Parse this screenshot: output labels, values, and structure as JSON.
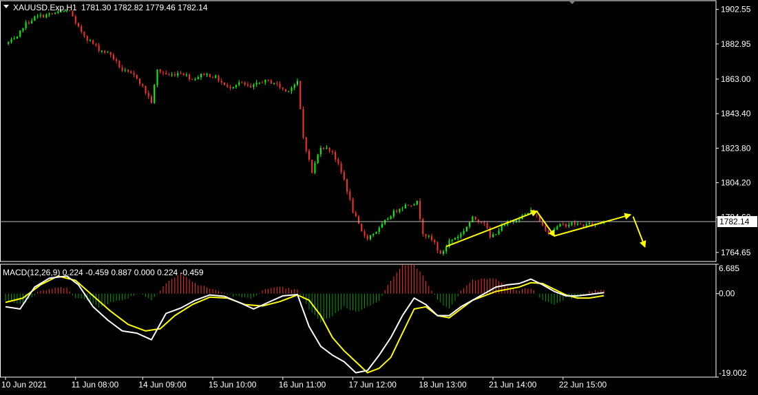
{
  "colors": {
    "background": "#000000",
    "frame": "#ffffff",
    "bull_candle": "#00ff00",
    "bear_candle": "#ff3030",
    "price_line": "#c0c0c0",
    "macd_main": "#ffffff",
    "macd_signal": "#ffff00",
    "hist_pos": "#ff3030",
    "hist_neg": "#00a000",
    "arrow": "#ffff00",
    "label_text": "#ffffff",
    "current_price_bg": "#ffffff",
    "current_price_text": "#000000"
  },
  "header": {
    "symbol_timeframe": "XAUUSD.Exp,H1",
    "ohlc": "1781.30 1782.82 1779.46 1782.14",
    "menu_icon": "triangle-down-icon"
  },
  "chart_data": [
    {
      "type": "candlestick",
      "y_ticks": [
        "1902.55",
        "1882.95",
        "1863.00",
        "1843.40",
        "1823.80",
        "1804.20",
        "1784.60",
        "1764.65"
      ],
      "ylim": [
        1759.5,
        1907.5
      ],
      "current_price": 1782.14,
      "current_price_label": "1782.14",
      "x_tick_labels": [
        "10 Jun 2021",
        "11 Jun 08:00",
        "14 Jun 09:00",
        "15 Jun 10:00",
        "16 Jun 11:00",
        "17 Jun 12:00",
        "18 Jun 13:00",
        "21 Jun 14:00",
        "22 Jun 15:00"
      ],
      "x_tick_bar_index": [
        0,
        24,
        47,
        71,
        95,
        119,
        143,
        167,
        191
      ],
      "grid": false,
      "anchors": [
        [
          0,
          1883
        ],
        [
          4,
          1886
        ],
        [
          6,
          1893
        ],
        [
          10,
          1898
        ],
        [
          16,
          1900
        ],
        [
          22,
          1902
        ],
        [
          24,
          1894
        ],
        [
          28,
          1886
        ],
        [
          32,
          1880
        ],
        [
          36,
          1877
        ],
        [
          40,
          1868
        ],
        [
          45,
          1864
        ],
        [
          50,
          1850
        ],
        [
          52,
          1868
        ],
        [
          56,
          1865
        ],
        [
          60,
          1867
        ],
        [
          64,
          1863
        ],
        [
          68,
          1866
        ],
        [
          72,
          1864
        ],
        [
          76,
          1858
        ],
        [
          80,
          1861
        ],
        [
          84,
          1858
        ],
        [
          88,
          1862
        ],
        [
          92,
          1861
        ],
        [
          96,
          1856
        ],
        [
          100,
          1861
        ],
        [
          102,
          1830
        ],
        [
          105,
          1810
        ],
        [
          108,
          1825
        ],
        [
          112,
          1822
        ],
        [
          116,
          1806
        ],
        [
          119,
          1788
        ],
        [
          122,
          1776
        ],
        [
          124,
          1773
        ],
        [
          128,
          1778
        ],
        [
          132,
          1786
        ],
        [
          135,
          1790
        ],
        [
          138,
          1792
        ],
        [
          141,
          1793
        ],
        [
          143,
          1776
        ],
        [
          147,
          1770
        ],
        [
          149,
          1763
        ],
        [
          152,
          1771
        ],
        [
          156,
          1775
        ],
        [
          160,
          1784
        ],
        [
          164,
          1782
        ],
        [
          166,
          1773
        ],
        [
          170,
          1779
        ],
        [
          174,
          1783
        ],
        [
          178,
          1786
        ],
        [
          180,
          1788
        ],
        [
          182,
          1785
        ],
        [
          184,
          1780
        ],
        [
          186,
          1776
        ],
        [
          190,
          1780
        ],
        [
          194,
          1781
        ],
        [
          198,
          1780
        ],
        [
          203,
          1781
        ],
        [
          205,
          1782.14
        ]
      ],
      "annotations": [
        {
          "type": "arrow",
          "from": [
            151,
            1768
          ],
          "to": [
            182,
            1788
          ]
        },
        {
          "type": "arrow",
          "from": [
            182,
            1788
          ],
          "to": [
            188,
            1774
          ]
        },
        {
          "type": "arrow",
          "from": [
            188,
            1774
          ],
          "to": [
            214,
            1786
          ]
        },
        {
          "type": "arrow",
          "from": [
            215,
            1785
          ],
          "to": [
            219,
            1768
          ]
        }
      ]
    },
    {
      "type": "line",
      "title": "MACD(12,26,9) 0.224 -0.459 0.887 0.000 0.224 -0.459",
      "y_ticks": [
        "6.685",
        "0.00",
        "-19.002"
      ],
      "ylim": [
        -19.002,
        6.685
      ],
      "series": [
        {
          "role": "main",
          "points": [
            [
              0,
              -3
            ],
            [
              5,
              -3.5
            ],
            [
              10,
              1.5
            ],
            [
              15,
              3.5
            ],
            [
              21,
              4
            ],
            [
              25,
              2
            ],
            [
              30,
              -3
            ],
            [
              35,
              -6
            ],
            [
              40,
              -8.5
            ],
            [
              45,
              -9
            ],
            [
              50,
              -10.5
            ],
            [
              55,
              -4.5
            ],
            [
              60,
              -3.3
            ],
            [
              65,
              -1.5
            ],
            [
              70,
              -0.3
            ],
            [
              75,
              -0.6
            ],
            [
              80,
              -2
            ],
            [
              85,
              -3.5
            ],
            [
              90,
              -2
            ],
            [
              95,
              -0.5
            ],
            [
              100,
              -0.2
            ],
            [
              104,
              -7.5
            ],
            [
              108,
              -12
            ],
            [
              112,
              -14
            ],
            [
              116,
              -15.5
            ],
            [
              120,
              -18
            ],
            [
              124,
              -17.5
            ],
            [
              128,
              -14
            ],
            [
              132,
              -10
            ],
            [
              136,
              -5
            ],
            [
              140,
              -1
            ],
            [
              144,
              -2.5
            ],
            [
              148,
              -5
            ],
            [
              152,
              -5
            ],
            [
              156,
              -3
            ],
            [
              160,
              -1.5
            ],
            [
              164,
              0
            ],
            [
              168,
              1.5
            ],
            [
              172,
              2
            ],
            [
              176,
              2.3
            ],
            [
              180,
              3.3
            ],
            [
              184,
              2
            ],
            [
              188,
              0.5
            ],
            [
              192,
              -0.5
            ],
            [
              196,
              -0.5
            ],
            [
              200,
              -0.2
            ],
            [
              205,
              0.224
            ]
          ]
        },
        {
          "role": "signal",
          "points": [
            [
              0,
              -2
            ],
            [
              6,
              -1
            ],
            [
              12,
              2
            ],
            [
              18,
              4
            ],
            [
              24,
              3
            ],
            [
              30,
              -0.5
            ],
            [
              36,
              -4
            ],
            [
              42,
              -7
            ],
            [
              48,
              -8.5
            ],
            [
              53,
              -8
            ],
            [
              58,
              -5
            ],
            [
              64,
              -2.5
            ],
            [
              70,
              -0.8
            ],
            [
              76,
              -1
            ],
            [
              82,
              -2.5
            ],
            [
              88,
              -2.8
            ],
            [
              94,
              -1.8
            ],
            [
              100,
              -0.3
            ],
            [
              104,
              -1.5
            ],
            [
              108,
              -5
            ],
            [
              112,
              -10
            ],
            [
              116,
              -13
            ],
            [
              120,
              -15.5
            ],
            [
              124,
              -18
            ],
            [
              128,
              -17
            ],
            [
              132,
              -14.5
            ],
            [
              136,
              -9
            ],
            [
              140,
              -3.5
            ],
            [
              144,
              -3
            ],
            [
              148,
              -5
            ],
            [
              152,
              -5.5
            ],
            [
              156,
              -3.5
            ],
            [
              160,
              -1.5
            ],
            [
              164,
              -0.5
            ],
            [
              168,
              0.5
            ],
            [
              172,
              1
            ],
            [
              176,
              1.5
            ],
            [
              180,
              2.5
            ],
            [
              184,
              2.3
            ],
            [
              188,
              1
            ],
            [
              192,
              -0.3
            ],
            [
              196,
              -1
            ],
            [
              200,
              -1
            ],
            [
              205,
              -0.459
            ]
          ]
        },
        {
          "role": "histogram",
          "points": [
            [
              0,
              -1.5
            ],
            [
              6,
              -2.5
            ],
            [
              11,
              0.3
            ],
            [
              16,
              1.2
            ],
            [
              21,
              1.5
            ],
            [
              24,
              -1
            ],
            [
              28,
              -1.5
            ],
            [
              32,
              -3
            ],
            [
              36,
              -2
            ],
            [
              40,
              -1.5
            ],
            [
              46,
              0.2
            ],
            [
              50,
              -1.5
            ],
            [
              55,
              2.5
            ],
            [
              60,
              4.5
            ],
            [
              66,
              2
            ],
            [
              72,
              0.8
            ],
            [
              78,
              -0.5
            ],
            [
              84,
              -1.2
            ],
            [
              88,
              0.8
            ],
            [
              94,
              1.5
            ],
            [
              100,
              0.8
            ],
            [
              104,
              -3.5
            ],
            [
              108,
              -6.5
            ],
            [
              112,
              -5
            ],
            [
              116,
              -3
            ],
            [
              120,
              -4.2
            ],
            [
              124,
              -3
            ],
            [
              128,
              -1.5
            ],
            [
              132,
              3
            ],
            [
              136,
              6.5
            ],
            [
              140,
              6.8
            ],
            [
              144,
              3
            ],
            [
              148,
              -1.5
            ],
            [
              152,
              -3.5
            ],
            [
              156,
              0.5
            ],
            [
              160,
              3
            ],
            [
              164,
              3.5
            ],
            [
              168,
              3.3
            ],
            [
              172,
              1.5
            ],
            [
              176,
              0.8
            ],
            [
              180,
              1.3
            ],
            [
              184,
              -1.5
            ],
            [
              188,
              -2.5
            ],
            [
              192,
              -1
            ],
            [
              196,
              -1
            ],
            [
              200,
              0.5
            ],
            [
              205,
              0.887
            ]
          ]
        }
      ]
    }
  ]
}
